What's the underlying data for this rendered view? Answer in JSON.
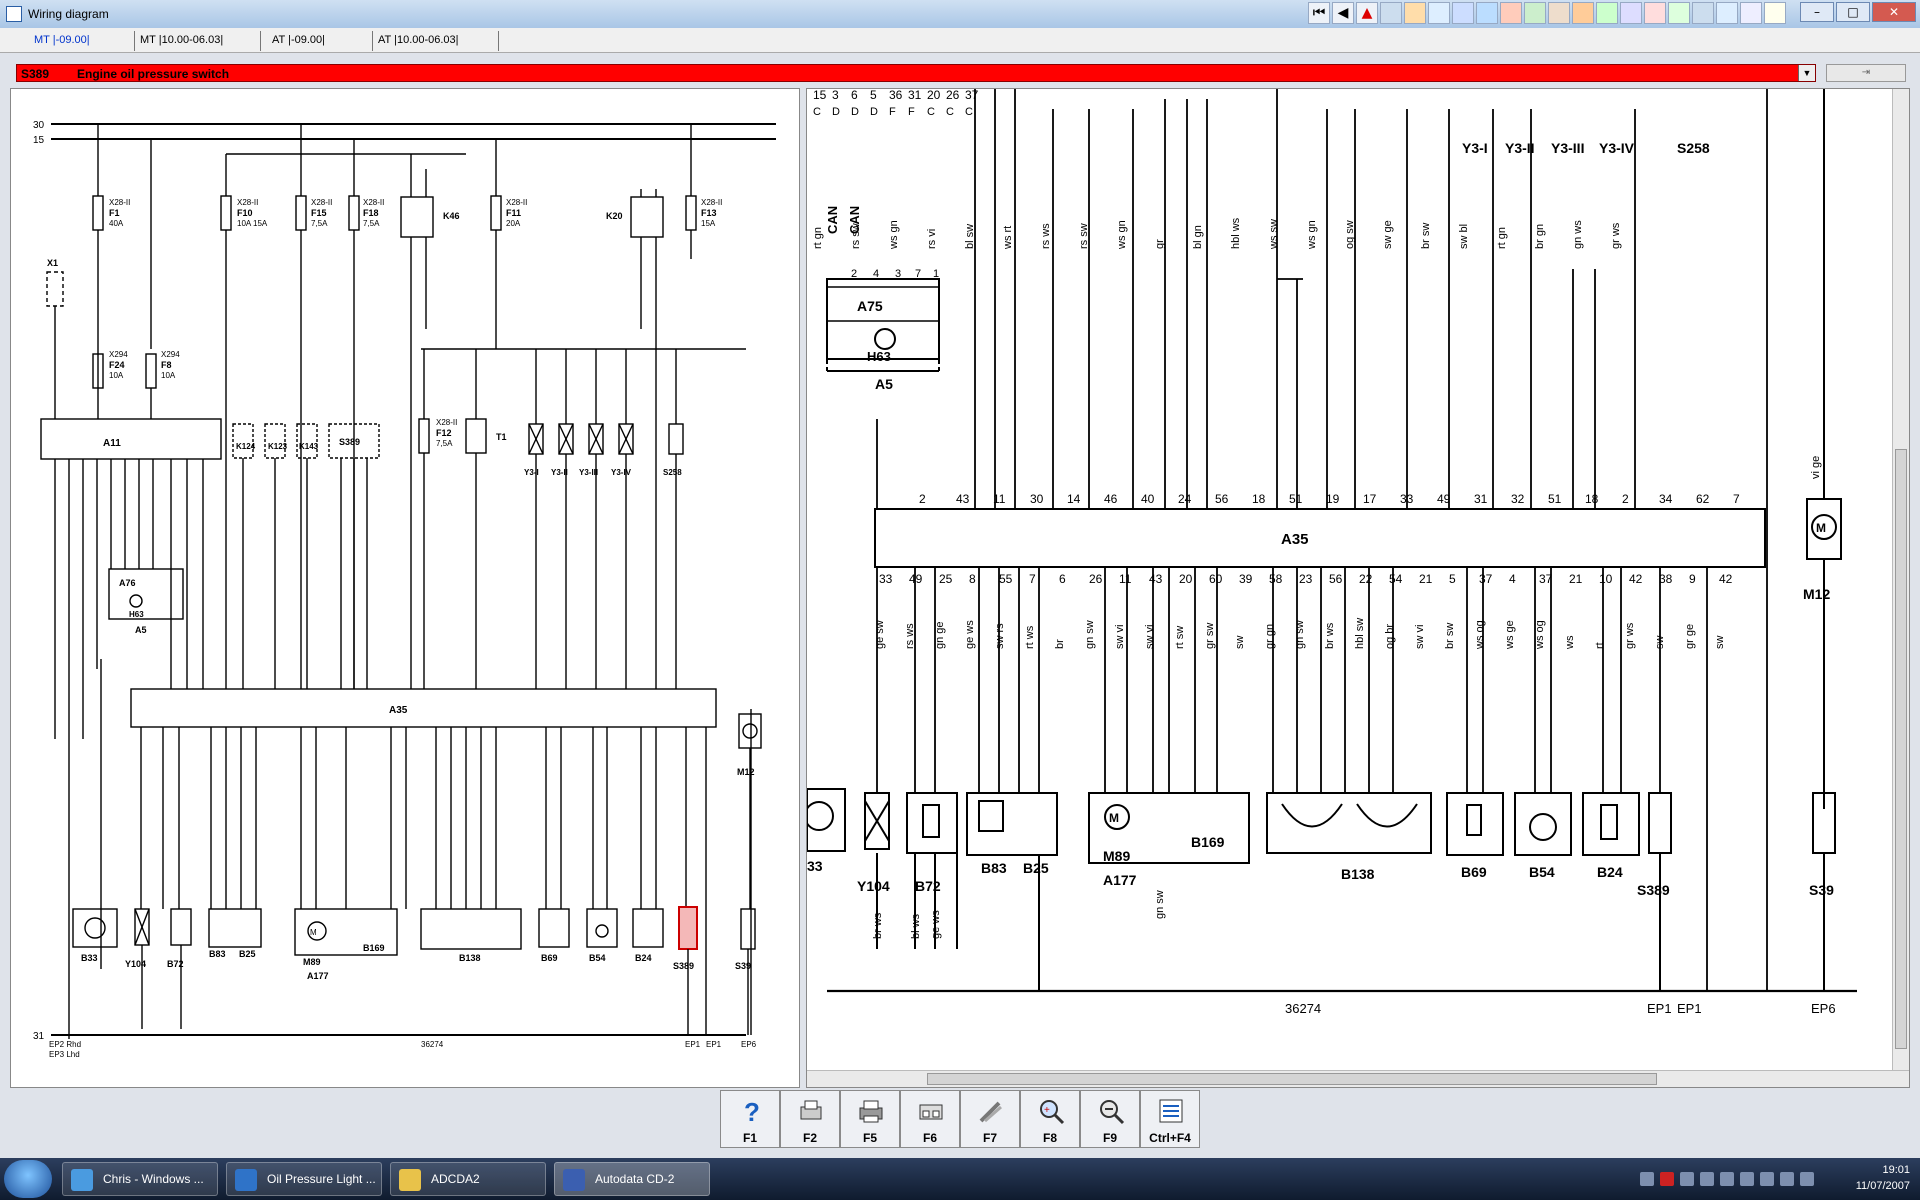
{
  "window": {
    "title": "Wiring diagram",
    "buttons": {
      "minimize": "–",
      "maximize": "□",
      "close": "✕"
    }
  },
  "tabs": [
    {
      "label": "MT |-09.00|"
    },
    {
      "label": "MT |10.00-06.03|"
    },
    {
      "label": "AT |-09.00|"
    },
    {
      "label": "AT |10.00-06.03|"
    }
  ],
  "component_bar": {
    "code": "S389",
    "name": "Engine oil pressure switch"
  },
  "left_diagram": {
    "rails": [
      "30",
      "15",
      "31"
    ],
    "fuses": [
      {
        "id": "F1",
        "conn": "X28-II",
        "rating": "40A"
      },
      {
        "id": "F10",
        "conn": "X28-II",
        "rating": "10A 15A"
      },
      {
        "id": "F15",
        "conn": "X28-II",
        "rating": "7,5A"
      },
      {
        "id": "F18",
        "conn": "X28-II",
        "rating": "7,5A"
      },
      {
        "id": "F11",
        "conn": "X28-II",
        "rating": "20A"
      },
      {
        "id": "F13",
        "conn": "X28-II",
        "rating": "15A"
      },
      {
        "id": "F24",
        "conn": "X294",
        "rating": "10A"
      },
      {
        "id": "F8",
        "conn": "X294",
        "rating": "10A"
      },
      {
        "id": "F12",
        "conn": "X28-II",
        "rating": "7,5A"
      }
    ],
    "relays": [
      "K46",
      "K20"
    ],
    "top_labels": [
      "X1",
      "T1",
      "Y3-I",
      "Y3-II",
      "Y3-III",
      "Y3-IV",
      "S258"
    ],
    "modules": [
      "A11",
      "K124",
      "K123",
      "K143",
      "S389",
      "A76",
      "H63",
      "A5",
      "A35"
    ],
    "bottom_components": [
      "B33",
      "Y104",
      "B72",
      "B83",
      "B25",
      "M89",
      "B169",
      "A177",
      "B138",
      "B69",
      "B54",
      "B24",
      "S389",
      "S39",
      "M12"
    ],
    "ground_labels": {
      "left1": "EP2 Rhd",
      "left2": "EP3 Lhd",
      "center": "36274",
      "ep1a": "EP1",
      "ep1b": "EP1",
      "ep6": "EP6"
    }
  },
  "right_diagram": {
    "top_pins": [
      "15",
      "3",
      "6",
      "5",
      "36",
      "31",
      "20",
      "26",
      "37"
    ],
    "top_pin_letters": [
      "C",
      "D",
      "D",
      "D",
      "F",
      "F",
      "C",
      "C",
      "C"
    ],
    "top_wires": [
      "rt gn",
      "rs sw",
      "ws gn",
      "rs vi",
      "bl sw",
      "ws rt",
      "rs ws",
      "rs sw",
      "ws gn",
      "gr",
      "bl gn",
      "hbl ws",
      "ws sw",
      "ws gn",
      "og sw",
      "sw ge",
      "br sw",
      "sw bl",
      "rt gn",
      "br gn",
      "gn ws",
      "gr ws"
    ],
    "can_labels": [
      "CAN",
      "CAN"
    ],
    "valve_labels": [
      "Y3-I",
      "Y3-II",
      "Y3-III",
      "Y3-IV",
      "S258"
    ],
    "a75": {
      "label": "A75",
      "sub": "H63",
      "group": "A5",
      "pins": [
        "2",
        "4",
        "3",
        "7",
        "1"
      ]
    },
    "a35": {
      "label": "A35",
      "top_pins": [
        "2",
        "43",
        "11",
        "30",
        "14",
        "46",
        "40",
        "24",
        "56",
        "18",
        "51",
        "19",
        "17",
        "33",
        "49",
        "31",
        "32",
        "51",
        "18",
        "2",
        "34",
        "62",
        "7"
      ],
      "bottom_pins": [
        "33",
        "49",
        "25",
        "8",
        "55",
        "7",
        "6",
        "26",
        "11",
        "43",
        "20",
        "60",
        "39",
        "58",
        "23",
        "56",
        "22",
        "54",
        "21",
        "5",
        "37",
        "4",
        "37",
        "21",
        "10",
        "42",
        "38",
        "9",
        "42"
      ],
      "bottom_wires": [
        "ge sw",
        "rs ws",
        "gn ge",
        "ge ws",
        "sw rs",
        "rt ws",
        "br",
        "gn sw",
        "sw vi",
        "sw vi",
        "rt sw",
        "gr sw",
        "sw",
        "gr gn",
        "gn sw",
        "br ws",
        "hbl sw",
        "og br",
        "sw vi",
        "br sw",
        "ws og",
        "ws ge",
        "ws og",
        "ws",
        "rt",
        "gr ws",
        "sw",
        "gr ge",
        "sw"
      ]
    },
    "components": [
      {
        "label": "33"
      },
      {
        "label": "Y104"
      },
      {
        "label": "B72"
      },
      {
        "label": "B83"
      },
      {
        "label": "B25"
      },
      {
        "label": "M89"
      },
      {
        "label": "B169"
      },
      {
        "label": "A177"
      },
      {
        "label": "B138"
      },
      {
        "label": "B69"
      },
      {
        "label": "B54"
      },
      {
        "label": "B24"
      },
      {
        "label": "S389"
      },
      {
        "label": "S39"
      },
      {
        "label": "M12"
      }
    ],
    "m12_wire": "vi ge",
    "ground_center": "36274",
    "ground_labels": [
      "EP1",
      "EP1",
      "EP6"
    ],
    "bottom_wires": [
      "br ws",
      "bl ws",
      "ge ws",
      "gn sw"
    ]
  },
  "function_keys": [
    {
      "key": "F1",
      "icon": "help-icon"
    },
    {
      "key": "F2",
      "icon": "print-setup-icon"
    },
    {
      "key": "F5",
      "icon": "printer-icon"
    },
    {
      "key": "F6",
      "icon": "pages-icon"
    },
    {
      "key": "F7",
      "icon": "tools-icon"
    },
    {
      "key": "F8",
      "icon": "zoom-in-icon"
    },
    {
      "key": "F9",
      "icon": "zoom-out-icon"
    },
    {
      "key": "Ctrl+F4",
      "icon": "list-icon"
    }
  ],
  "taskbar": {
    "items": [
      {
        "label": "Chris - Windows ...",
        "color": "#4a9be0"
      },
      {
        "label": "Oil Pressure Light ...",
        "color": "#2f73c8"
      },
      {
        "label": "ADCDA2",
        "color": "#e8c24a"
      },
      {
        "label": "Autodata CD-2",
        "color": "#3b5fb0"
      }
    ],
    "time": "19:01",
    "date": "11/07/2007"
  }
}
